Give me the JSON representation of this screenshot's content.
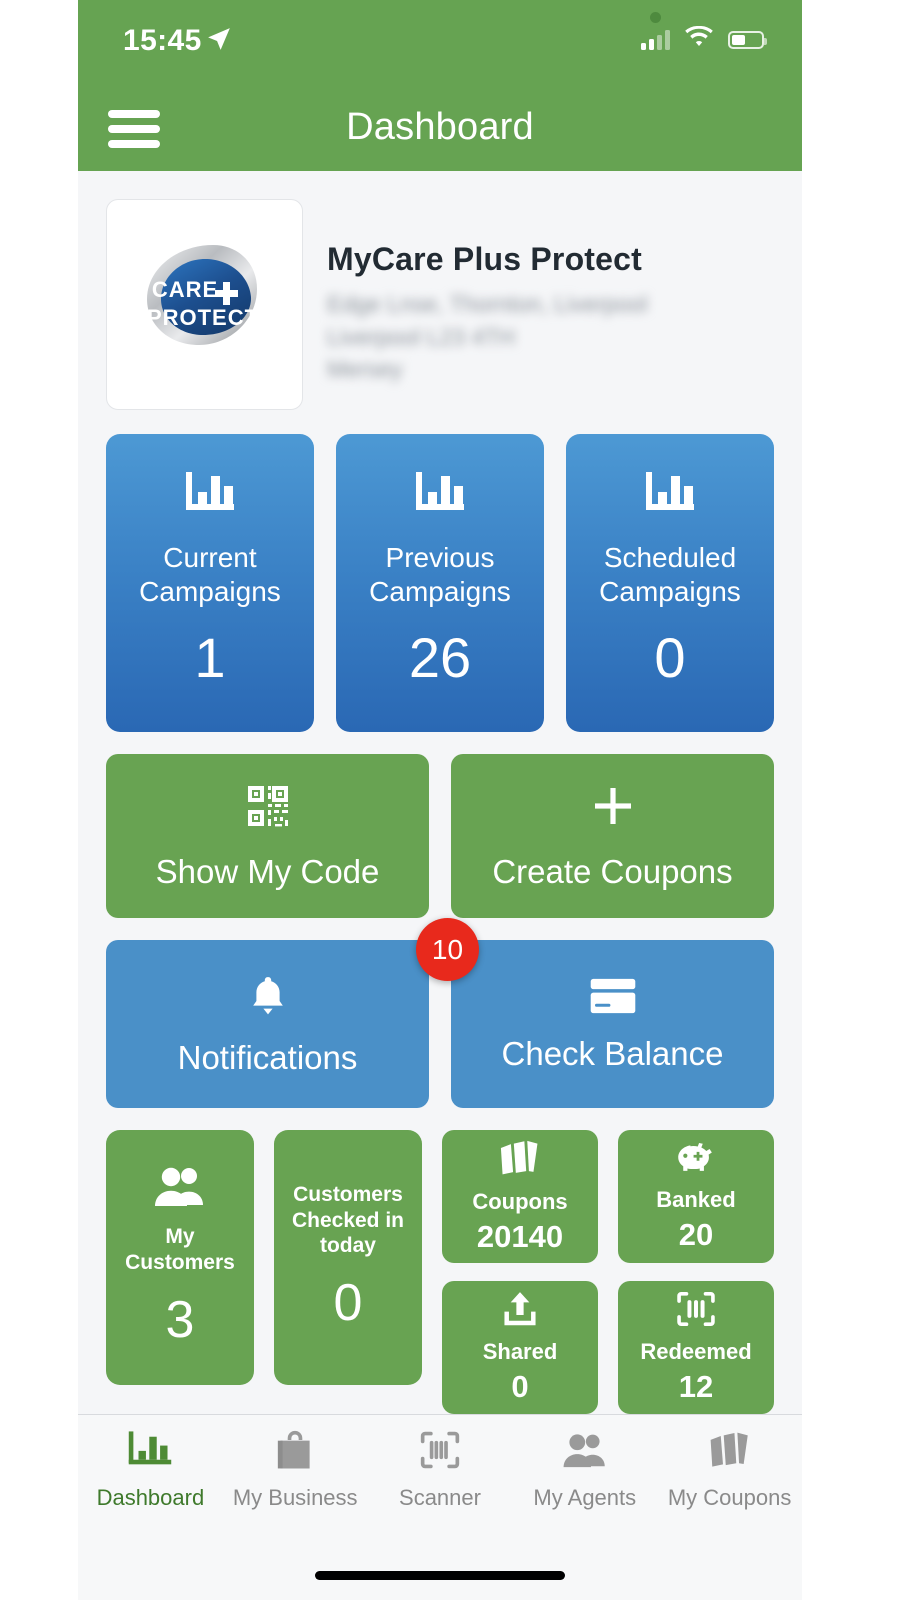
{
  "statusbar": {
    "time": "15:45",
    "location_icon": "location-arrow-icon",
    "signal_icon": "cellular-signal-icon",
    "wifi_icon": "wifi-icon",
    "battery_icon": "battery-icon"
  },
  "navbar": {
    "menu_icon": "hamburger-menu-icon",
    "title": "Dashboard"
  },
  "business": {
    "logo_alt": "CARE + PROTECT",
    "logo_line1": "CARE",
    "logo_line2": "PROTECT",
    "name": "MyCare Plus Protect",
    "address_line1": "Edge Lnse, Thornton, Liverpool",
    "address_line2": "Liverpool L23 4TH",
    "address_line3": "Mersey"
  },
  "campaigns": [
    {
      "label": "Current\nCampaigns",
      "label_l1": "Current",
      "label_l2": "Campaigns",
      "value": "1",
      "icon": "bar-chart-icon"
    },
    {
      "label": "Previous\nCampaigns",
      "label_l1": "Previous",
      "label_l2": "Campaigns",
      "value": "26",
      "icon": "bar-chart-icon"
    },
    {
      "label": "Scheduled\nCampaigns",
      "label_l1": "Scheduled",
      "label_l2": "Campaigns",
      "value": "0",
      "icon": "bar-chart-icon"
    }
  ],
  "actions": [
    {
      "label": "Show My Code",
      "icon": "qr-code-icon"
    },
    {
      "label": "Create Coupons",
      "icon": "plus-icon"
    }
  ],
  "notifications": {
    "label": "Notifications",
    "icon": "bell-icon",
    "badge_count": "10",
    "badge_color": "#e8291c"
  },
  "check_balance": {
    "label": "Check Balance",
    "icon": "credit-card-icon"
  },
  "stats_tall": [
    {
      "label": "My Customers",
      "value": "3",
      "icon": "people-icon",
      "has_icon": true
    },
    {
      "label_l1": "Customers",
      "label_l2": "Checked in",
      "label_l3": "today",
      "value": "0",
      "icon": "",
      "has_icon": false
    }
  ],
  "stats_small": [
    {
      "label": "Coupons",
      "value": "20140",
      "icon": "tickets-icon"
    },
    {
      "label": "Banked",
      "value": "20",
      "icon": "piggy-bank-icon"
    },
    {
      "label": "Shared",
      "value": "0",
      "icon": "upload-icon"
    },
    {
      "label": "Redeemed",
      "value": "12",
      "icon": "barcode-scan-icon"
    }
  ],
  "tabbar": [
    {
      "label": "Dashboard",
      "icon": "bar-chart-icon",
      "active": true
    },
    {
      "label": "My Business",
      "icon": "shopping-bag-icon",
      "active": false
    },
    {
      "label": "Scanner",
      "icon": "barcode-scan-icon",
      "active": false
    },
    {
      "label": "My Agents",
      "icon": "people-icon",
      "active": false
    },
    {
      "label": "My Coupons",
      "icon": "tickets-icon",
      "active": false
    }
  ],
  "colors": {
    "header_green": "#66a352",
    "tile_green": "#68a352",
    "tile_blue": "#4a90c8",
    "campaign_blue_top": "#4d99d4",
    "campaign_blue_bottom": "#2a68b4",
    "badge_red": "#e8291c",
    "active_tab": "#3f7a2c",
    "page_bg": "#f5f6f8"
  }
}
